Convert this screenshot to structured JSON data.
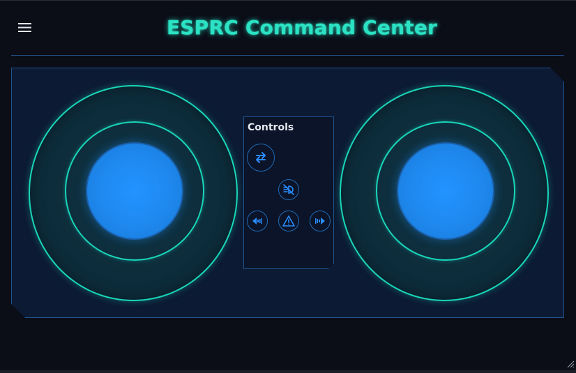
{
  "header": {
    "title": "ESPRC Command Center",
    "menu_icon": "hamburger-menu-icon"
  },
  "controls": {
    "title": "Controls",
    "buttons": [
      {
        "name": "swap",
        "icon": "swap-arrows-icon"
      },
      {
        "name": "lights-off",
        "icon": "headlights-off-icon"
      },
      {
        "name": "left-indicator",
        "icon": "left-turn-signal-icon"
      },
      {
        "name": "hazard",
        "icon": "hazard-warning-icon"
      },
      {
        "name": "right-indicator",
        "icon": "right-turn-signal-icon"
      }
    ]
  },
  "joysticks": [
    {
      "name": "left-joystick"
    },
    {
      "name": "right-joystick"
    }
  ],
  "colors": {
    "background": "#0b0d17",
    "accent": "#2be3c4",
    "ring": "#19d6b8",
    "knob": "#1e88ee",
    "panel": "#0c1a33",
    "panel_border": "#1f5590"
  }
}
